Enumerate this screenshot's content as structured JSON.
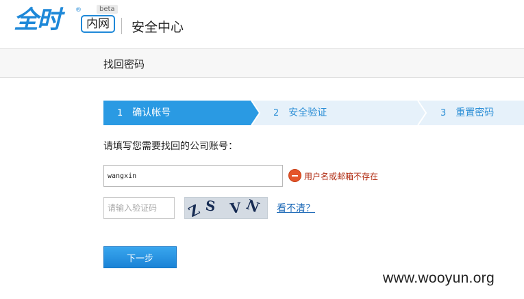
{
  "header": {
    "logo_text": "全时",
    "logo_reg": "®",
    "intranet_label": "内网",
    "beta_badge": "beta",
    "site_title": "安全中心"
  },
  "subbar": {
    "title": "找回密码"
  },
  "steps": [
    {
      "num": "1",
      "label": "确认帐号",
      "active": true
    },
    {
      "num": "2",
      "label": "安全验证",
      "active": false
    },
    {
      "num": "3",
      "label": "重置密码",
      "active": false
    }
  ],
  "colors": {
    "step_active": "#2a9ae3",
    "step_inactive": "#e6f1fa",
    "button": "#1f8ee0",
    "error": "#b02a10"
  },
  "form": {
    "prompt": "请填写您需要找回的公司账号：",
    "username_value": "wangxin",
    "error_text": "用户名或邮箱不存在",
    "captcha_placeholder": "请输入验证码",
    "captcha_chars": [
      "Z",
      "S",
      "V",
      "N"
    ],
    "refresh_link": "看不清？",
    "next_button": "下一步"
  },
  "watermark": "www.wooyun.org"
}
